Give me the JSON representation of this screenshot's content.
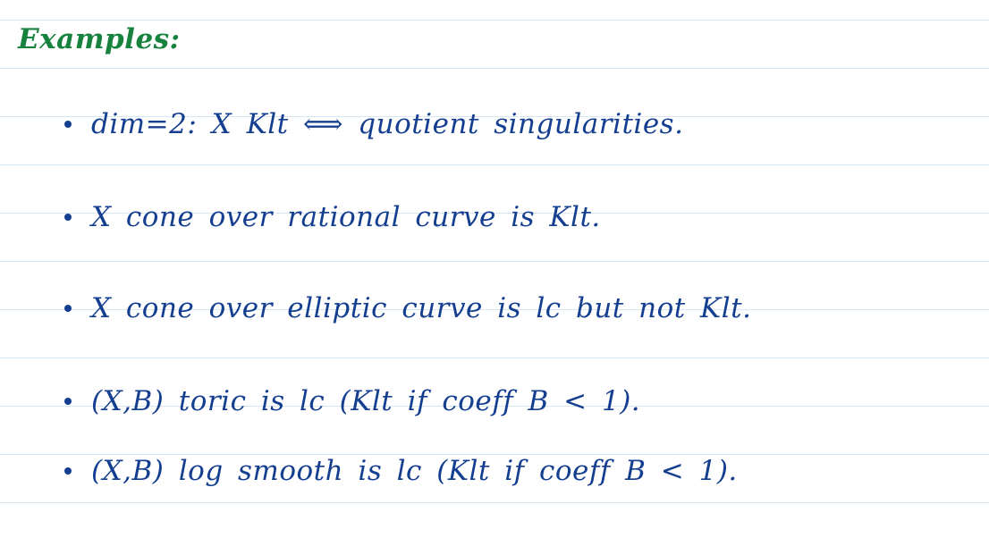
{
  "heading": "Examples:",
  "examples": [
    "dim=2:  X Klt ⟺ quotient singularities.",
    "X cone over rational curve is Klt.",
    "X cone over elliptic curve is lc but not Klt.",
    "(X,B) toric is lc (Klt if coeff B < 1).",
    "(X,B) log smooth is lc (Klt if coeff B < 1)."
  ],
  "colors": {
    "heading": "#17823d",
    "ink": "#143e8f",
    "rule": "#d6e7f1"
  }
}
